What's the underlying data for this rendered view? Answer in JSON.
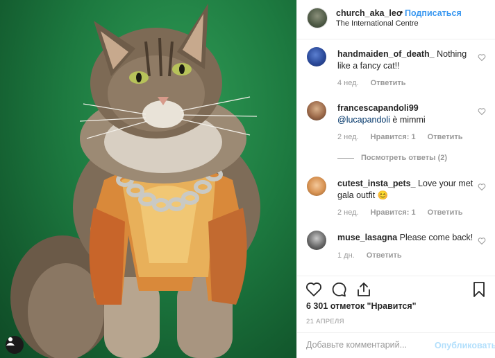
{
  "post": {
    "image_alt": "cat-photo",
    "username": "church_aka_leo",
    "separator": "•",
    "follow_label": "Подписаться",
    "location": "The International Centre"
  },
  "comments": [
    {
      "username": "handmaiden_of_death_",
      "text": " Nothing like a fancy cat!!",
      "time": "4 нед.",
      "reply": "Ответить"
    },
    {
      "username": "francescapandoli99",
      "mention": "@lucapandoli",
      "text": " è mimmi",
      "time": "2 нед.",
      "likes": "Нравится: 1",
      "reply": "Ответить",
      "view_replies": "Посмотреть ответы (2)"
    },
    {
      "username": "cutest_insta_pets_",
      "text": " Love your met gala outfit 😊",
      "time": "2 нед.",
      "likes": "Нравится: 1",
      "reply": "Ответить"
    },
    {
      "username": "muse_lasagna",
      "text": " Please come back!",
      "time": "1 дн.",
      "reply": "Ответить"
    }
  ],
  "actions": {
    "like_icon": "heart-icon",
    "comment_icon": "comment-icon",
    "share_icon": "share-icon",
    "save_icon": "bookmark-icon"
  },
  "likes_count": "6 301 отметок \"Нравится\"",
  "date": "21 АПРЕЛЯ",
  "add_comment": {
    "placeholder": "Добавьте комментарий...",
    "publish_label": "Опубликовать"
  },
  "colors": {
    "link_blue": "#3897f0",
    "publish_disabled": "#b2dffc",
    "meta_gray": "#999999",
    "text": "#262626"
  }
}
